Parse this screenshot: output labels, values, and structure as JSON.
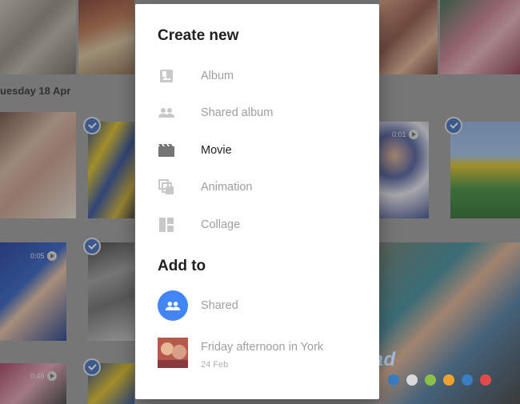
{
  "background": {
    "date_label": "uesday 18 Apr",
    "video_durations": [
      "0:01",
      "0:05",
      "0:46"
    ]
  },
  "dialog": {
    "create_title": "Create new",
    "create_items": [
      {
        "label": "Album",
        "icon": "album-icon"
      },
      {
        "label": "Shared album",
        "icon": "people-icon"
      },
      {
        "label": "Movie",
        "icon": "movie-icon"
      },
      {
        "label": "Animation",
        "icon": "animation-icon"
      },
      {
        "label": "Collage",
        "icon": "collage-icon"
      }
    ],
    "add_title": "Add to",
    "add_items": [
      {
        "label": "Shared",
        "icon": "people-icon"
      },
      {
        "label": "Friday afternoon in York",
        "sublabel": "24 Feb"
      }
    ]
  },
  "watermark": "Download",
  "colors": {
    "accent": "#4285f4",
    "check": "#3d6bbd",
    "dots": [
      "#3b7dc4",
      "#d9d9d9",
      "#8cc04b",
      "#f0a030",
      "#3b7dc4",
      "#e24b4b"
    ]
  }
}
